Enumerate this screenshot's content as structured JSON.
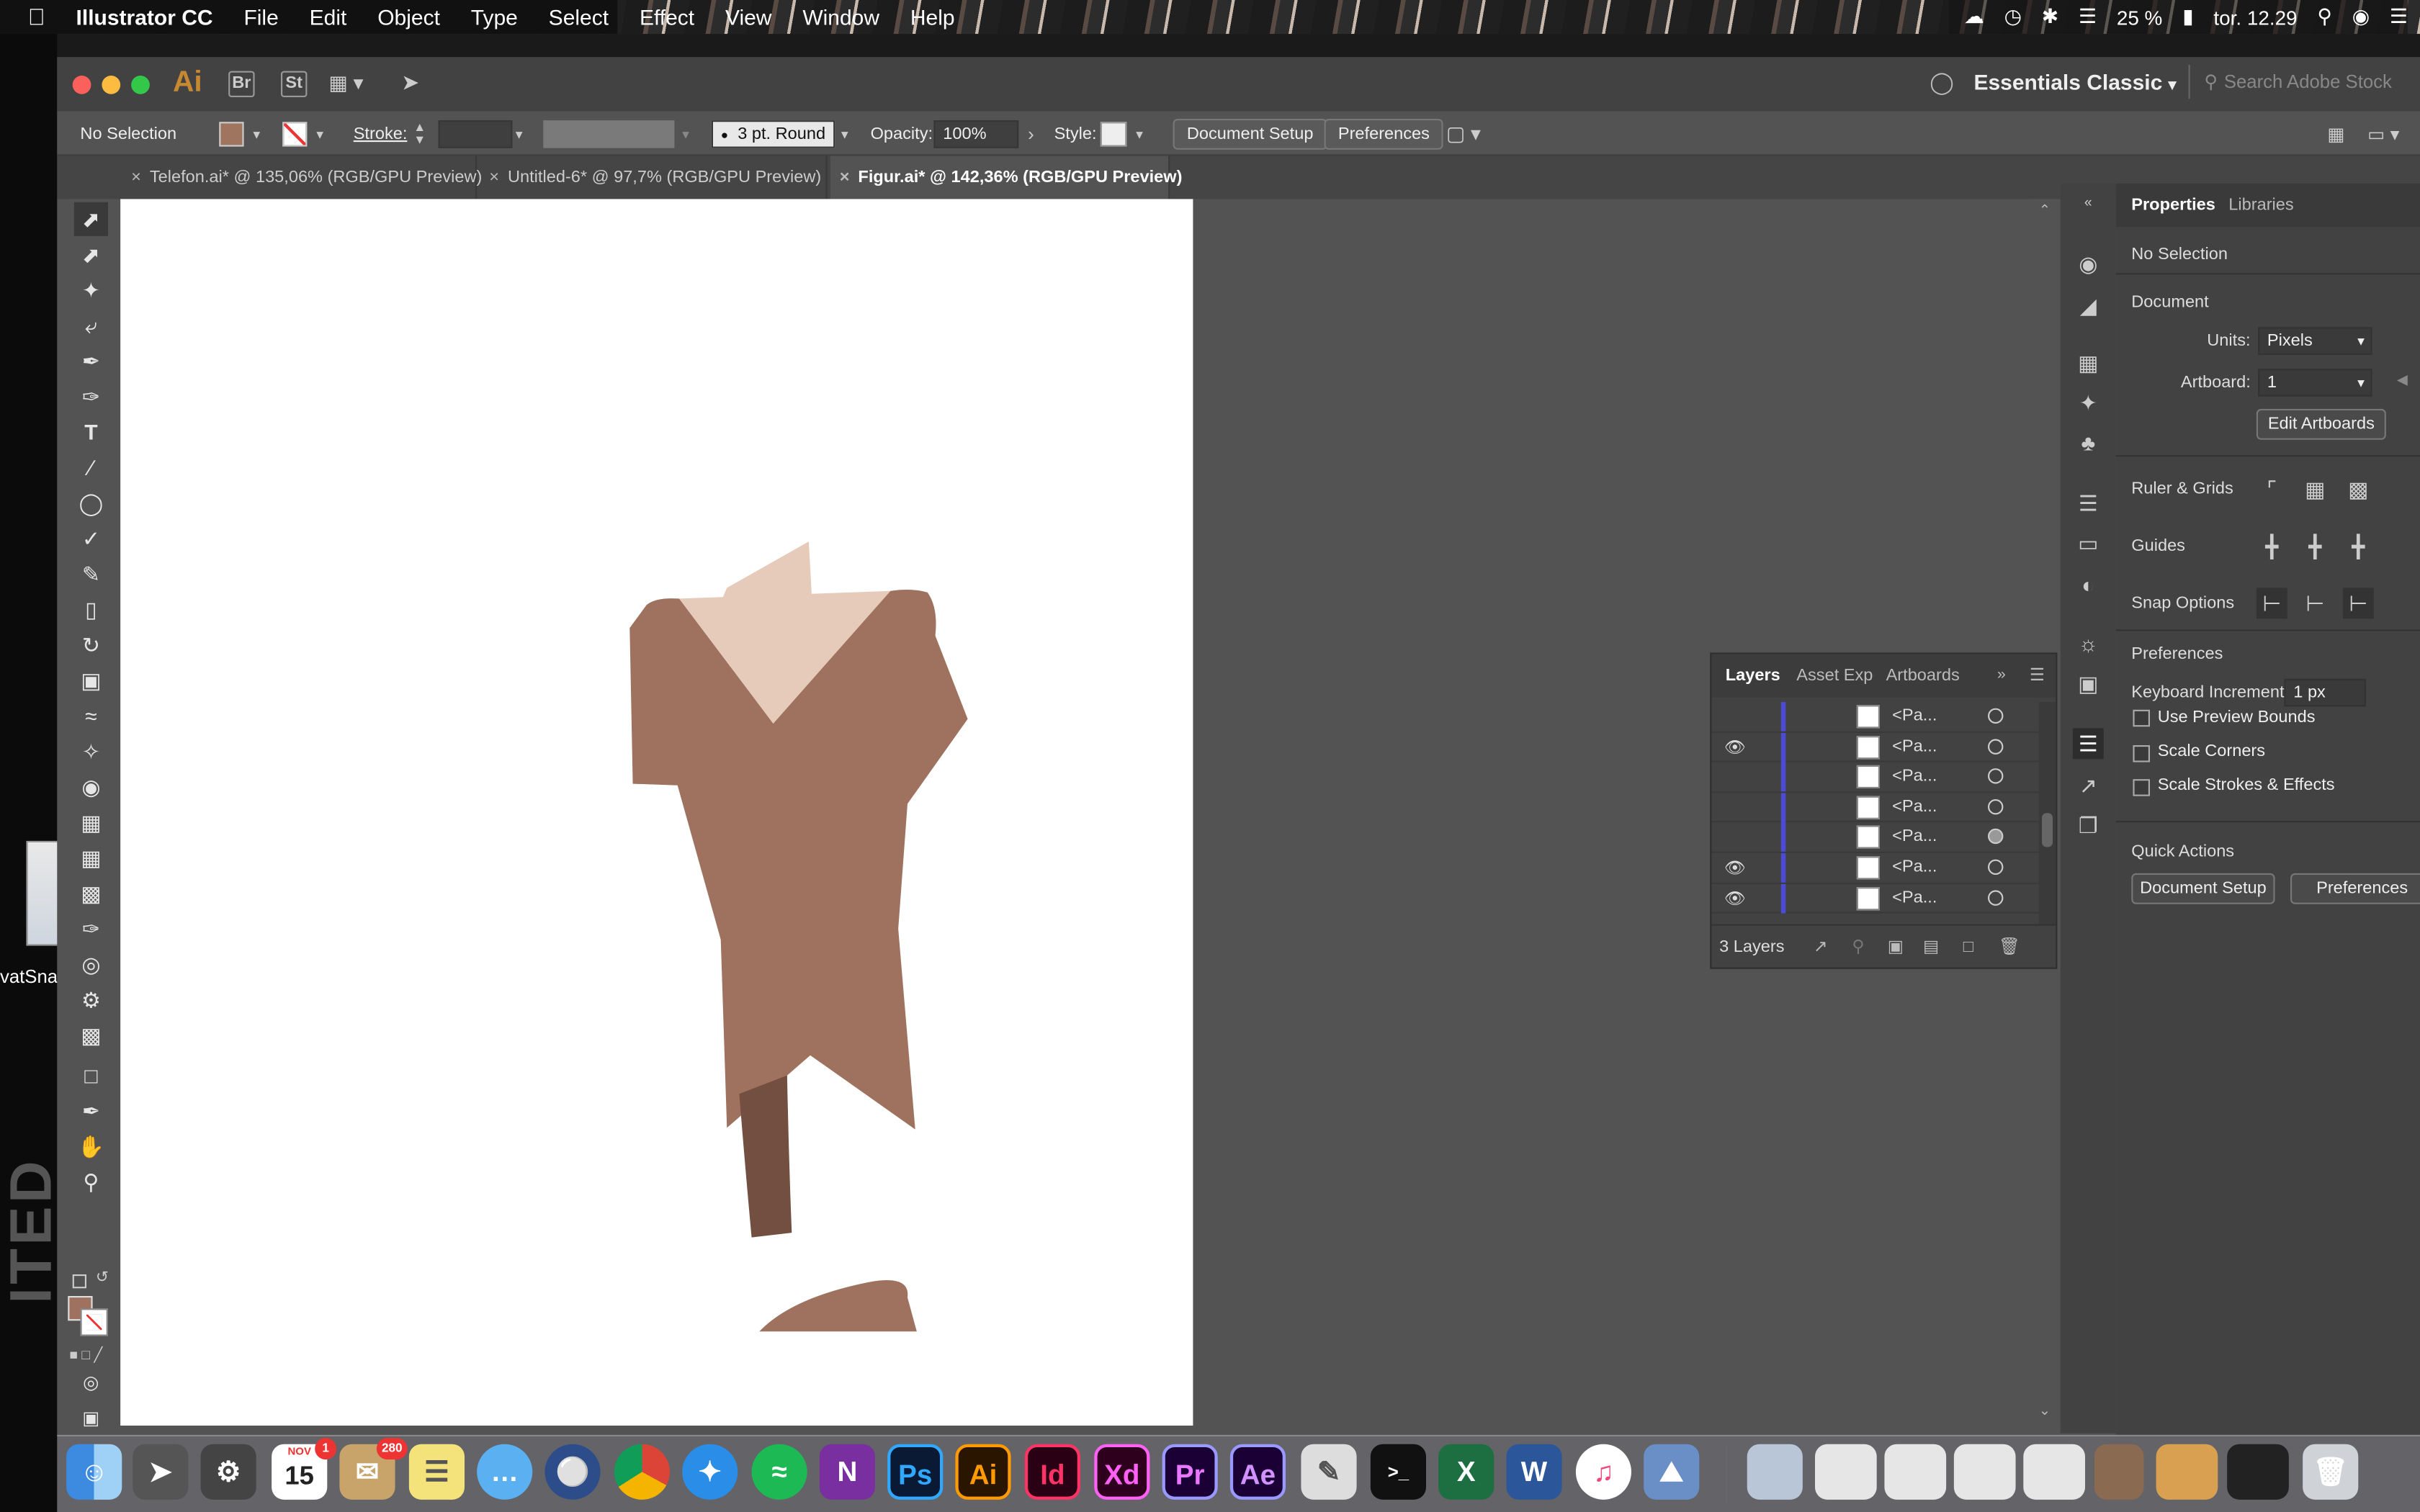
{
  "menubar": {
    "app_name": "Illustrator CC",
    "items": [
      "File",
      "Edit",
      "Object",
      "Type",
      "Select",
      "Effect",
      "View",
      "Window",
      "Help"
    ],
    "battery": "25 %",
    "clock": "tor. 12.29"
  },
  "desktop": {
    "icon_label": "vatSna",
    "big_text": "ITED"
  },
  "titlebar": {
    "logo": "Ai",
    "bridge": "Br",
    "stock": "St",
    "workspace": "Essentials Classic",
    "search_placeholder": "Search Adobe Stock"
  },
  "control": {
    "selection": "No Selection",
    "stroke_label": "Stroke:",
    "brush": "3 pt. Round",
    "opacity_label": "Opacity:",
    "opacity_value": "100%",
    "style_label": "Style:",
    "document_setup": "Document Setup",
    "preferences": "Preferences",
    "fill_color": "#a07560"
  },
  "tabs": [
    {
      "label": "Telefon.ai* @ 135,06% (RGB/GPU Preview)"
    },
    {
      "label": "Untitled-6* @ 97,7% (RGB/GPU Preview)"
    },
    {
      "label": "Figur.ai* @ 142,36% (RGB/GPU Preview)"
    }
  ],
  "artwork": {
    "body_color": "#9e725e",
    "skin_color": "#e6cbba",
    "leg_color": "#724f40",
    "shoe_color": "#9e725e"
  },
  "layers_panel": {
    "tabs": [
      "Layers",
      "Asset Expo",
      "Artboards"
    ],
    "rows": [
      {
        "name": "<Pa...",
        "visible": false,
        "filled": false
      },
      {
        "name": "<Pa...",
        "visible": true,
        "filled": false
      },
      {
        "name": "<Pa...",
        "visible": false,
        "filled": false
      },
      {
        "name": "<Pa...",
        "visible": false,
        "filled": false
      },
      {
        "name": "<Pa...",
        "visible": false,
        "filled": true
      },
      {
        "name": "<Pa...",
        "visible": true,
        "filled": false
      },
      {
        "name": "<Pa...",
        "visible": true,
        "filled": false
      }
    ],
    "footer": "3 Layers"
  },
  "properties": {
    "tab_properties": "Properties",
    "tab_libraries": "Libraries",
    "selection": "No Selection",
    "document": "Document",
    "units_label": "Units:",
    "units_value": "Pixels",
    "artboard_label": "Artboard:",
    "artboard_value": "1",
    "edit_artboards": "Edit Artboards",
    "ruler_grids": "Ruler & Grids",
    "guides": "Guides",
    "snap_options": "Snap Options",
    "preferences_head": "Preferences",
    "keyboard_increment_label": "Keyboard Increment:",
    "keyboard_increment_value": "1 px",
    "use_preview_bounds": "Use Preview Bounds",
    "scale_corners": "Scale Corners",
    "scale_strokes": "Scale Strokes & Effects",
    "quick_actions": "Quick Actions",
    "qa_document_setup": "Document Setup",
    "qa_preferences": "Preferences"
  },
  "dock": {
    "calendar_month": "NOV",
    "calendar_day": "15",
    "calendar_badge": "1",
    "mail_badge": "280",
    "apps": [
      "Ps",
      "Ai",
      "Id",
      "Xd",
      "Pr",
      "Ae"
    ]
  }
}
